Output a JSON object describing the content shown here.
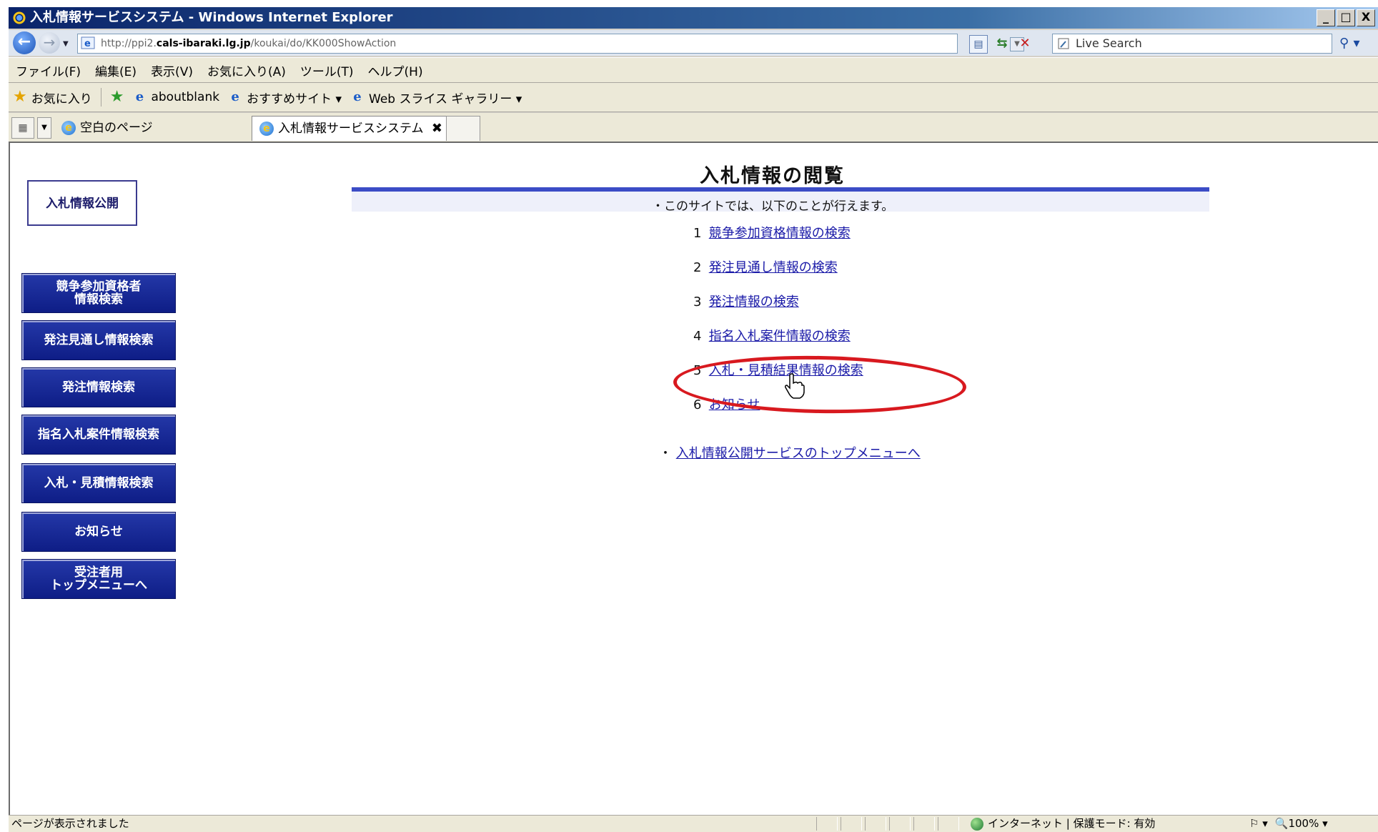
{
  "window": {
    "title": "入札情報サービスシステム - Windows Internet Explorer",
    "minimize": "_",
    "maximize": "□",
    "close": "X"
  },
  "address": {
    "url_prefix": "http://ppi2.",
    "url_domain": "cals-ibaraki.lg.jp",
    "url_path": "/koukai/do/KK000ShowAction",
    "search_placeholder": "Live Search"
  },
  "menu": [
    "ファイル(F)",
    "編集(E)",
    "表示(V)",
    "お気に入り(A)",
    "ツール(T)",
    "ヘルプ(H)"
  ],
  "favorites": {
    "favorites_label": "お気に入り",
    "items": [
      {
        "label": "aboutblank"
      },
      {
        "label": "おすすめサイト ▾"
      },
      {
        "label": "Web スライス ギャラリー ▾"
      }
    ]
  },
  "tabs": {
    "blank_tab": "空白のページ",
    "active_tab": "入札情報サービスシステム",
    "close": "✖"
  },
  "sidebar": {
    "logo": "入札情報公開",
    "buttons": [
      {
        "label": "競争参加資格者\n情報検索"
      },
      {
        "label": "発注見通し情報検索"
      },
      {
        "label": "発注情報検索"
      },
      {
        "label": "指名入札案件情報検索"
      },
      {
        "label": "入札・見積情報検索"
      },
      {
        "label": "お知らせ"
      },
      {
        "label": "受注者用\nトップメニューへ"
      }
    ]
  },
  "main": {
    "heading": "入札情報の閲覧",
    "intro": "・このサイトでは、以下のことが行えます。",
    "items": [
      {
        "num": "1",
        "label": "競争参加資格情報の検索"
      },
      {
        "num": "2",
        "label": "発注見通し情報の検索"
      },
      {
        "num": "3",
        "label": "発注情報の検索"
      },
      {
        "num": "4",
        "label": "指名入札案件情報の検索"
      },
      {
        "num": "5",
        "label": "入札・見積結果情報の検索"
      },
      {
        "num": "6",
        "label": "お知らせ"
      }
    ],
    "top_link_bullet": "・",
    "top_link": "入札情報公開サービスのトップメニューへ"
  },
  "status": {
    "text": "ページが表示されました",
    "zone": "インターネット | 保護モード: 有効",
    "zoom": "100%"
  },
  "colors": {
    "sidebar_button": "#1a2b9e",
    "link": "#1a1aa8",
    "annotation": "#d8191f",
    "heading_rule": "#3b4cc6"
  }
}
